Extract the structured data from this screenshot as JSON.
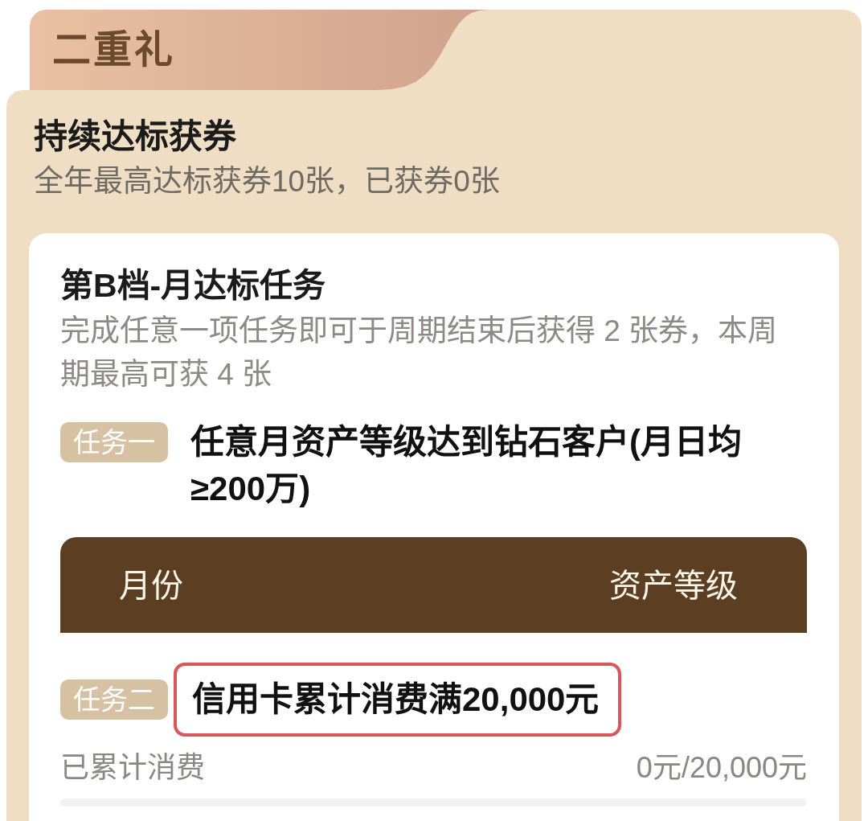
{
  "section_tab": {
    "label": "二重礼"
  },
  "header": {
    "title": "持续达标获券",
    "subtitle": "全年最高达标获券10张，已获券0张"
  },
  "tier_card": {
    "title": "第B档-月达标任务",
    "description": "完成任意一项任务即可于周期结束后获得 2 张券，本周期最高可获 4 张",
    "tasks": [
      {
        "kind": "table",
        "tag": "任务一",
        "title": "任意月资产等级达到钻石客户(月日均≥200万)",
        "highlighted": false,
        "table": {
          "columns": [
            "月份",
            "资产等级"
          ]
        }
      },
      {
        "kind": "progress",
        "tag": "任务二",
        "title": "信用卡累计消费满20,000元",
        "highlighted": true,
        "progress": {
          "label": "已累计消费",
          "reading": "0元/20,000元"
        }
      }
    ]
  }
}
